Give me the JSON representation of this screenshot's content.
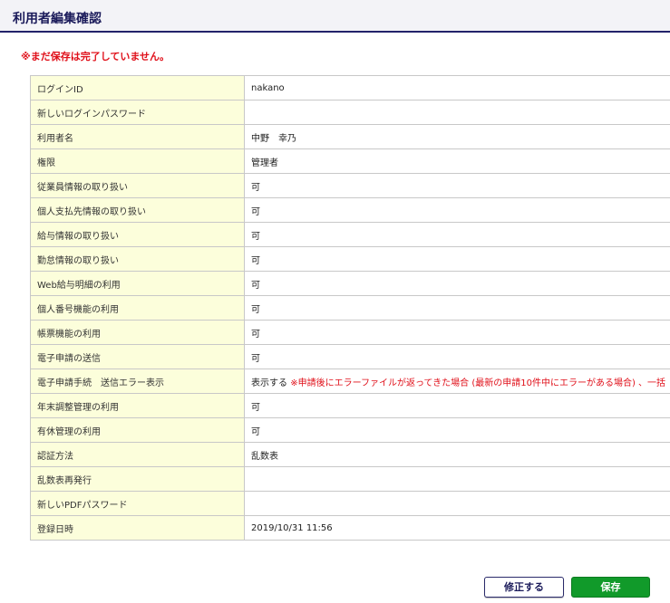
{
  "header": {
    "title": "利用者編集確認"
  },
  "warning": "※まだ保存は完了していません。",
  "rows": [
    {
      "label": "ログインID",
      "value": "nakano"
    },
    {
      "label": "新しいログインパスワード",
      "value": ""
    },
    {
      "label": "利用者名",
      "value": "中野　幸乃"
    },
    {
      "label": "権限",
      "value": "管理者"
    },
    {
      "label": "従業員情報の取り扱い",
      "value": "可"
    },
    {
      "label": "個人支払先情報の取り扱い",
      "value": "可"
    },
    {
      "label": "給与情報の取り扱い",
      "value": "可"
    },
    {
      "label": "勤怠情報の取り扱い",
      "value": "可"
    },
    {
      "label": "Web給与明細の利用",
      "value": "可"
    },
    {
      "label": "個人番号機能の利用",
      "value": "可"
    },
    {
      "label": "帳票機能の利用",
      "value": "可"
    },
    {
      "label": "電子申請の送信",
      "value": "可"
    },
    {
      "label": "電子申請手続　送信エラー表示",
      "value": "表示する",
      "note": "※申請後にエラーファイルが返ってきた場合 (最新の申請10件中にエラーがある場合) 、一括"
    },
    {
      "label": "年末調整管理の利用",
      "value": "可"
    },
    {
      "label": "有休管理の利用",
      "value": "可"
    },
    {
      "label": "認証方法",
      "value": "乱数表"
    },
    {
      "label": "乱数表再発行",
      "value": ""
    },
    {
      "label": "新しいPDFパスワード",
      "value": ""
    },
    {
      "label": "登録日時",
      "value": "2019/10/31 11:56"
    }
  ],
  "buttons": {
    "edit_label": "修正する",
    "save_label": "保存"
  },
  "colors": {
    "header_border": "#22226a",
    "warning": "#e0101a",
    "label_bg": "#fcfedb",
    "save_button": "#119a2a"
  }
}
